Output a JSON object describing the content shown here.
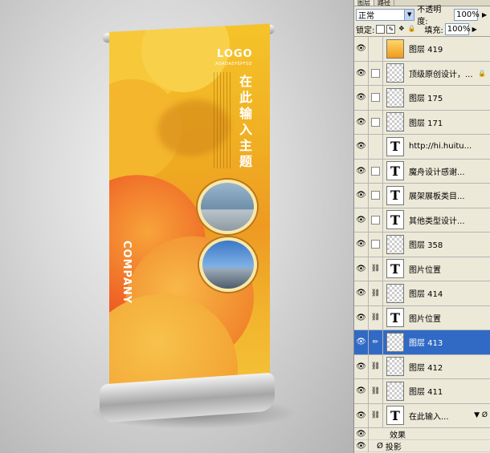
{
  "canvas": {
    "logo": "LOGO",
    "logo_sub": "AOADAEPEPFSD",
    "vertical_title": "在此输入主题",
    "company": "COMPANY"
  },
  "panel": {
    "tabs": [
      "图层",
      "路径"
    ],
    "blend_mode": "正常",
    "opacity_label": "不透明度:",
    "opacity_value": "100%",
    "lock_label": "锁定:",
    "fill_label": "填充:",
    "fill_value": "100%",
    "layers": [
      {
        "name": "图层 419",
        "thumb": "orange",
        "link": "none",
        "selected": false
      },
      {
        "name": "顶级原创设计，...",
        "thumb": "check",
        "link": "box",
        "locked": true,
        "selected": false
      },
      {
        "name": "图层 175",
        "thumb": "check",
        "link": "box",
        "selected": false
      },
      {
        "name": "图层 171",
        "thumb": "check",
        "link": "box",
        "selected": false
      },
      {
        "name": "http://hi.huitu...",
        "thumb": "text",
        "link": "none",
        "selected": false
      },
      {
        "name": "魔舟设计感谢...",
        "thumb": "text",
        "link": "box",
        "selected": false
      },
      {
        "name": "展架展板类目...",
        "thumb": "text",
        "link": "box",
        "selected": false
      },
      {
        "name": "其他类型设计...",
        "thumb": "text",
        "link": "box",
        "selected": false
      },
      {
        "name": "图层 358",
        "thumb": "check",
        "link": "box",
        "selected": false
      },
      {
        "name": "图片位置",
        "thumb": "text",
        "link": "chain",
        "selected": false
      },
      {
        "name": "图层 414",
        "thumb": "check",
        "link": "chain",
        "selected": false
      },
      {
        "name": "图片位置",
        "thumb": "text",
        "link": "chain",
        "selected": false
      },
      {
        "name": "图层 413",
        "thumb": "check",
        "link": "brush",
        "selected": true
      },
      {
        "name": "图层 412",
        "thumb": "check",
        "link": "chain",
        "selected": false
      },
      {
        "name": "图层 411",
        "thumb": "check",
        "link": "chain",
        "selected": false
      },
      {
        "name": "在此输入...",
        "thumb": "text",
        "link": "chain",
        "fx": true,
        "selected": false
      }
    ],
    "effects_label": "效果",
    "drop_shadow_label": "投影"
  },
  "colors": {
    "selected_row": "#316ac5",
    "panel_bg": "#ece9d8",
    "banner_yellow": "#f5c32a",
    "banner_orange": "#ee9a22"
  }
}
